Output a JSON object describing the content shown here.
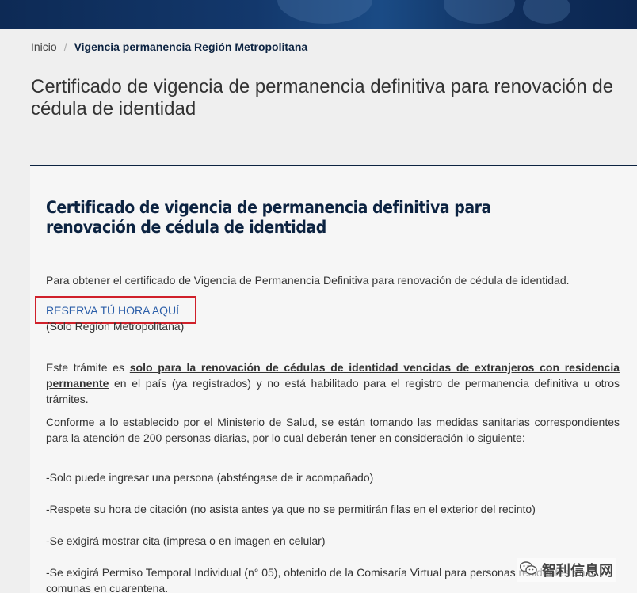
{
  "breadcrumb": {
    "home": "Inicio",
    "separator": "/",
    "current": "Vigencia permanencia Región Metropolitana"
  },
  "page_title": "Certificado de vigencia de permanencia definitiva para renovación de cédula de identidad",
  "card": {
    "title": "Certificado de vigencia de permanencia definitiva para renovación de cédula de identidad",
    "intro": "Para obtener el certificado de Vigencia de Permanencia Definitiva para renovación de cédula de identidad.",
    "reserve_link": "RESERVA TÚ HORA AQUÍ",
    "reserve_note": "(Solo Región Metropolitana)",
    "tramite_pre": "Este trámite es ",
    "tramite_bold": "solo para la renovación de cédulas de identidad vencidas de extranjeros con residencia permanente",
    "tramite_post": " en el país (ya registrados) y no está habilitado para el registro de permanencia definitiva u otros trámites.",
    "conforme": "Conforme a lo establecido por el Ministerio de Salud, se están tomando las medidas sanitarias correspondientes para la atención de 200 personas diarias, por lo cual deberán tener en consideración lo siguiente:",
    "rules": [
      "-Solo puede ingresar una persona (absténgase de ir acompañado)",
      "-Respete su hora de citación (no asista antes ya que no se permitirán filas en el exterior del recinto)",
      "-Se exigirá mostrar cita (impresa o en imagen en celular)",
      "-Se exigirá Permiso Temporal Individual (n° 05), obtenido de la Comisaría Virtual para personas residentes en comunas en cuarentena."
    ]
  },
  "watermark": {
    "icon": "wechat-icon",
    "text": "智利信息网"
  },
  "colors": {
    "banner": "#13386c",
    "title_navy": "#0c2341",
    "link_blue": "#2a5da8",
    "highlight_red": "#d0202a"
  }
}
